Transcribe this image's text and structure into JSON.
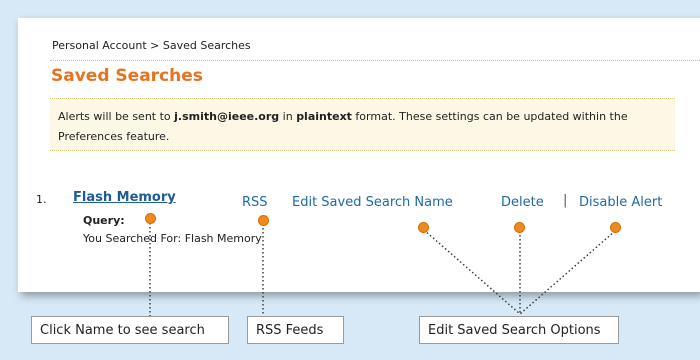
{
  "breadcrumb": "Personal Account > Saved Searches",
  "page_title": "Saved Searches",
  "notice": {
    "prefix": "Alerts will be sent to ",
    "email": "j.smith@ieee.org",
    "mid": " in ",
    "format": "plaintext",
    "suffix": " format. These settings can be updated within the Preferences feature."
  },
  "result": {
    "number": "1.",
    "name": "Flash Memory",
    "query_label": "Query:",
    "query_text": "You Searched For:  Flash Memory"
  },
  "actions": {
    "rss": "RSS",
    "edit_name": "Edit Saved Search Name",
    "delete": "Delete",
    "separator": "|",
    "disable_alert": "Disable Alert"
  },
  "callouts": {
    "name": "Click Name to see search",
    "rss": "RSS Feeds",
    "options": "Edit Saved Search Options"
  },
  "colors": {
    "background": "#d7e9f6",
    "title": "#e8731e",
    "link": "#1f6aa0",
    "dot": "#f28a1b"
  }
}
